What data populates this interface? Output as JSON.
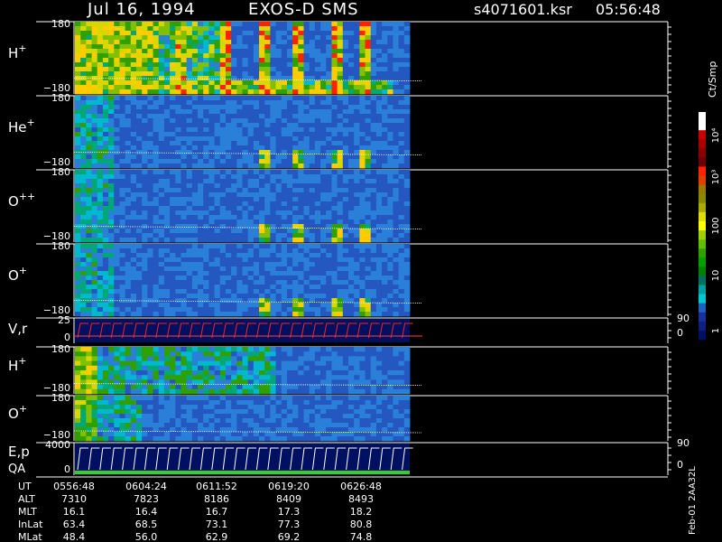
{
  "header": {
    "date": "Jul 16, 1994",
    "instrument": "EXOS-D SMS",
    "file": "s4071601.ksr",
    "time": "05:56:48"
  },
  "colorbar": {
    "label": "Ct/Smp",
    "ticks": [
      "10⁴",
      "10³",
      "100",
      "10",
      "1"
    ],
    "colors": [
      "#ffffff",
      "#ffffff",
      "#c80000",
      "#aa0000",
      "#8b0000",
      "#6e0000",
      "#ff2200",
      "#e04000",
      "#9a7a00",
      "#8a8a00",
      "#aaaa00",
      "#dddd00",
      "#ffff00",
      "#a0d000",
      "#60c000",
      "#30a000",
      "#00a000",
      "#008000",
      "#007060",
      "#00a0a0",
      "#00c8d0",
      "#2060c0",
      "#1830a0",
      "#102080",
      "#001060"
    ]
  },
  "panels": [
    {
      "label": "H",
      "charge": "+",
      "top_tick": "180",
      "bottom_tick": "−180"
    },
    {
      "label": "He",
      "charge": "+",
      "top_tick": "180",
      "bottom_tick": "−180"
    },
    {
      "label": "O",
      "charge": "++",
      "top_tick": "180",
      "bottom_tick": "−180"
    },
    {
      "label": "O",
      "charge": "+",
      "top_tick": "180",
      "bottom_tick": "−180"
    },
    {
      "label": "V,r",
      "charge": "",
      "top_tick": "25",
      "bottom_tick": "0",
      "right_top": "90",
      "right_bottom": "0"
    },
    {
      "label": "H",
      "charge": "+",
      "top_tick": "180",
      "bottom_tick": "−180"
    },
    {
      "label": "O",
      "charge": "+",
      "top_tick": "180",
      "bottom_tick": "−180"
    },
    {
      "label": "E,p",
      "label2": "QA",
      "charge": "",
      "top_tick": "4000",
      "bottom_tick": "0",
      "right_top": "90",
      "right_bottom": "0"
    }
  ],
  "orbit_table": {
    "rows": [
      {
        "name": "UT",
        "values": [
          "0556:48",
          "0604:24",
          "0611:52",
          "0619:20",
          "0626:48"
        ]
      },
      {
        "name": "ALT",
        "values": [
          "7310",
          "7823",
          "8186",
          "8409",
          "8493"
        ]
      },
      {
        "name": "MLT",
        "values": [
          "16.1",
          "16.4",
          "16.7",
          "17.3",
          "18.2"
        ]
      },
      {
        "name": "InLat",
        "values": [
          "63.4",
          "68.5",
          "73.1",
          "77.3",
          "80.8"
        ]
      },
      {
        "name": "MLat",
        "values": [
          "48.4",
          "56.0",
          "62.9",
          "69.2",
          "74.8"
        ]
      }
    ]
  },
  "footer_note": "Feb-01 2AA32L",
  "chart_data": {
    "type": "heatmap",
    "title": "Jul 16, 1994   EXOS-D SMS",
    "xlabel": "UT",
    "x_ticks": [
      "0556:48",
      "0604:24",
      "0611:52",
      "0619:20",
      "0626:48"
    ],
    "z_label": "Ct/Smp",
    "z_scale": "log",
    "z_range": [
      1,
      10000
    ],
    "panels": [
      {
        "name": "H+",
        "ylim": [
          -180,
          180
        ]
      },
      {
        "name": "He+",
        "ylim": [
          -180,
          180
        ]
      },
      {
        "name": "O++",
        "ylim": [
          -180,
          180
        ]
      },
      {
        "name": "O+",
        "ylim": [
          -180,
          180
        ]
      },
      {
        "name": "V,r",
        "ylim": [
          0,
          25
        ],
        "right_ylim": [
          0,
          90
        ]
      },
      {
        "name": "H+",
        "ylim": [
          -180,
          180
        ]
      },
      {
        "name": "O+",
        "ylim": [
          -180,
          180
        ]
      },
      {
        "name": "E,p / QA",
        "ylim": [
          0,
          4000
        ],
        "right_ylim": [
          0,
          90
        ]
      }
    ]
  }
}
